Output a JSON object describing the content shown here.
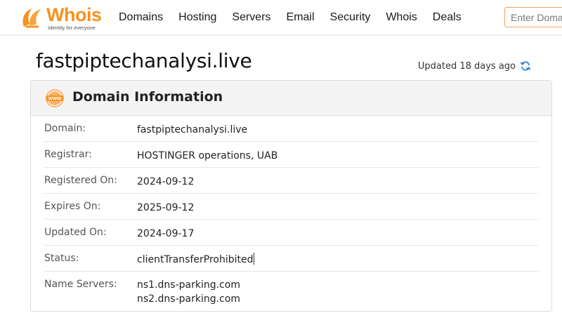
{
  "brand": {
    "name": "Whois",
    "tagline": "Identity for everyone",
    "color": "#f7931e"
  },
  "nav": {
    "items": [
      {
        "label": "Domains"
      },
      {
        "label": "Hosting"
      },
      {
        "label": "Servers"
      },
      {
        "label": "Email"
      },
      {
        "label": "Security"
      },
      {
        "label": "Whois"
      },
      {
        "label": "Deals"
      }
    ]
  },
  "search": {
    "placeholder": "Enter Domain"
  },
  "page": {
    "title": "fastpiptechanalysi.live",
    "updated": "Updated 18 days ago"
  },
  "card": {
    "title": "Domain Information",
    "icon": "www-icon",
    "rows": [
      {
        "label": "Domain:",
        "value": "fastpiptechanalysi.live"
      },
      {
        "label": "Registrar:",
        "value": "HOSTINGER operations, UAB"
      },
      {
        "label": "Registered On:",
        "value": "2024-09-12"
      },
      {
        "label": "Expires On:",
        "value": "2025-09-12"
      },
      {
        "label": "Updated On:",
        "value": "2024-09-17"
      },
      {
        "label": "Status:",
        "value": "clientTransferProhibited"
      },
      {
        "label": "Name Servers:",
        "values": [
          "ns1.dns-parking.com",
          "ns2.dns-parking.com"
        ]
      }
    ]
  },
  "colors": {
    "accent": "#f7931e",
    "refresh": "#2f80d1",
    "search_border": "#f0a35e"
  }
}
